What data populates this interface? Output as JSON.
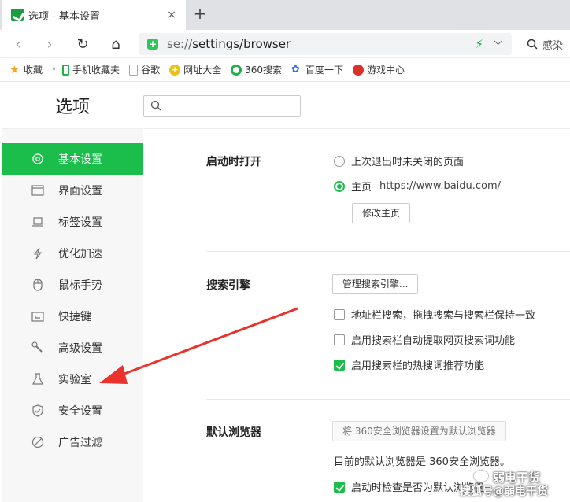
{
  "tab": {
    "title": "选项 - 基本设置",
    "close": "×",
    "new_tab": "+"
  },
  "toolbar": {
    "back": "‹",
    "forward": "›",
    "reload": "↻",
    "home": "⌂",
    "url_scheme": "se://",
    "url_path": "settings/browser",
    "search_placeholder": "感染",
    "accent": "#1bbd4b"
  },
  "bookmarks": [
    {
      "label": "收藏",
      "icon": "star-icon",
      "color": "#f5a623",
      "dropdown": true
    },
    {
      "label": "手机收藏夹",
      "icon": "phone-icon",
      "color": "#21b04b"
    },
    {
      "label": "谷歌",
      "icon": "page-icon",
      "color": "#cccccc"
    },
    {
      "label": "网址大全",
      "icon": "plus-badge-icon",
      "color": "#e8c21a"
    },
    {
      "label": "360搜索",
      "icon": "360-search-icon",
      "color": "#21b04b"
    },
    {
      "label": "百度一下",
      "icon": "baidu-paw-icon",
      "color": "#2b6de3"
    },
    {
      "label": "游戏中心",
      "icon": "game-icon",
      "color": "#d9322b"
    }
  ],
  "header": {
    "title": "选项"
  },
  "sidebar": {
    "items": [
      {
        "label": "基本设置",
        "icon": "gear-icon",
        "active": true
      },
      {
        "label": "界面设置",
        "icon": "window-icon",
        "active": false
      },
      {
        "label": "标签设置",
        "icon": "tab-icon",
        "active": false
      },
      {
        "label": "优化加速",
        "icon": "lightning-icon",
        "active": false
      },
      {
        "label": "鼠标手势",
        "icon": "mouse-icon",
        "active": false
      },
      {
        "label": "快捷键",
        "icon": "keyboard-icon",
        "active": false
      },
      {
        "label": "高级设置",
        "icon": "wrench-icon",
        "active": false
      },
      {
        "label": "实验室",
        "icon": "flask-icon",
        "active": false
      },
      {
        "label": "安全设置",
        "icon": "shield-icon",
        "active": false
      },
      {
        "label": "广告过滤",
        "icon": "block-icon",
        "active": false
      }
    ]
  },
  "startup": {
    "title": "启动时打开",
    "option1": "上次退出时未关闭的页面",
    "option2": "主页",
    "homepage_url": "https://www.baidu.com/",
    "modify_button": "修改主页"
  },
  "search_engine": {
    "title": "搜索引擎",
    "manage_button": "管理搜索引擎...",
    "check1": "地址栏搜索，拖拽搜索与搜索栏保持一致",
    "check2": "启用搜索栏自动提取网页搜索词功能",
    "check3": "启用搜索栏的热搜词推荐功能"
  },
  "default_browser": {
    "title": "默认浏览器",
    "set_button": "将 360安全浏览器设置为默认浏览器",
    "status": "目前的默认浏览器是 360安全浏览器。",
    "check": "启动时检查是否为默认浏览器"
  },
  "watermark": {
    "top": "弱电干货",
    "bottom": "搜狐号@弱电干货"
  }
}
